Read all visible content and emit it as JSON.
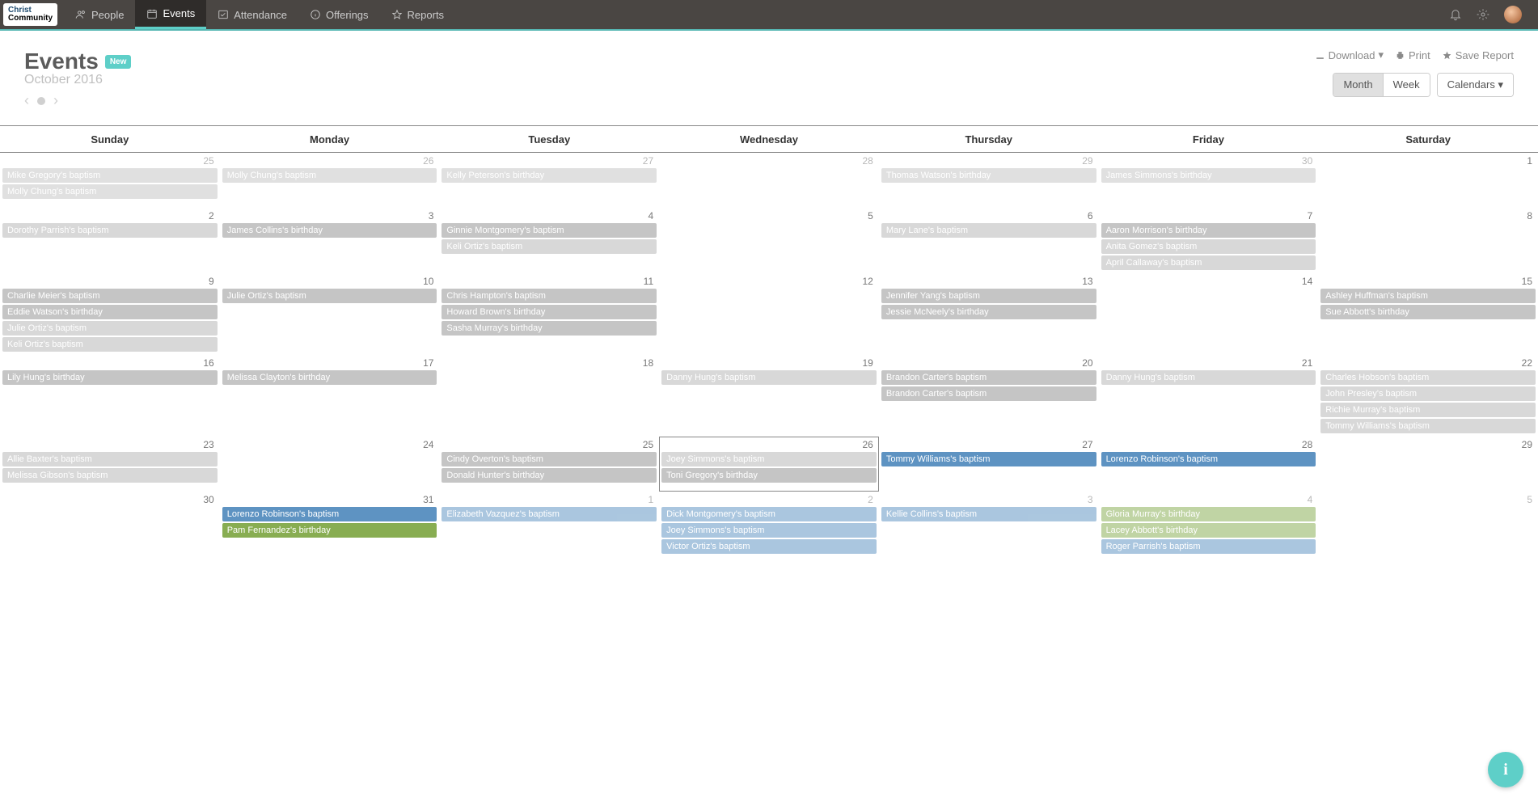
{
  "nav": {
    "logo_line1": "Christ",
    "logo_line2": "Community",
    "items": [
      {
        "label": "People",
        "icon": "people"
      },
      {
        "label": "Events",
        "icon": "calendar",
        "active": true
      },
      {
        "label": "Attendance",
        "icon": "check"
      },
      {
        "label": "Offerings",
        "icon": "info"
      },
      {
        "label": "Reports",
        "icon": "star"
      }
    ]
  },
  "header": {
    "title": "Events",
    "badge": "New",
    "subtitle": "October 2016",
    "actions": {
      "download": "Download",
      "print": "Print",
      "save": "Save Report"
    },
    "views": {
      "month": "Month",
      "week": "Week",
      "calendars": "Calendars"
    }
  },
  "dayheaders": [
    "Sunday",
    "Monday",
    "Tuesday",
    "Wednesday",
    "Thursday",
    "Friday",
    "Saturday"
  ],
  "weeks": [
    [
      {
        "num": "25",
        "other": true,
        "events": [
          {
            "t": "Mike Gregory's baptism",
            "c": "gray"
          },
          {
            "t": "Molly Chung's baptism",
            "c": "gray"
          }
        ]
      },
      {
        "num": "26",
        "other": true,
        "events": [
          {
            "t": "Molly Chung's baptism",
            "c": "gray"
          }
        ]
      },
      {
        "num": "27",
        "other": true,
        "events": [
          {
            "t": "Kelly Peterson's birthday",
            "c": "gray"
          }
        ]
      },
      {
        "num": "28",
        "other": true,
        "events": []
      },
      {
        "num": "29",
        "other": true,
        "events": [
          {
            "t": "Thomas Watson's birthday",
            "c": "gray"
          }
        ]
      },
      {
        "num": "30",
        "other": true,
        "events": [
          {
            "t": "James Simmons's birthday",
            "c": "gray"
          }
        ]
      },
      {
        "num": "1",
        "events": []
      }
    ],
    [
      {
        "num": "2",
        "events": [
          {
            "t": "Dorothy Parrish's baptism",
            "c": "lightgray"
          }
        ]
      },
      {
        "num": "3",
        "events": [
          {
            "t": "James Collins's birthday",
            "c": "gray"
          }
        ]
      },
      {
        "num": "4",
        "events": [
          {
            "t": "Ginnie Montgomery's baptism",
            "c": "gray"
          },
          {
            "t": "Keli Ortiz's baptism",
            "c": "lightgray"
          }
        ]
      },
      {
        "num": "5",
        "events": []
      },
      {
        "num": "6",
        "events": [
          {
            "t": "Mary Lane's baptism",
            "c": "lightgray"
          }
        ]
      },
      {
        "num": "7",
        "events": [
          {
            "t": "Aaron Morrison's birthday",
            "c": "gray"
          },
          {
            "t": "Anita Gomez's baptism",
            "c": "lightgray"
          },
          {
            "t": "April Callaway's baptism",
            "c": "lightgray"
          }
        ]
      },
      {
        "num": "8",
        "events": []
      }
    ],
    [
      {
        "num": "9",
        "events": [
          {
            "t": "Charlie Meier's baptism",
            "c": "gray"
          },
          {
            "t": "Eddie Watson's birthday",
            "c": "gray"
          },
          {
            "t": "Julie Ortiz's baptism",
            "c": "lightgray"
          },
          {
            "t": "Keli Ortiz's baptism",
            "c": "lightgray"
          }
        ]
      },
      {
        "num": "10",
        "events": [
          {
            "t": "Julie Ortiz's baptism",
            "c": "gray"
          }
        ]
      },
      {
        "num": "11",
        "events": [
          {
            "t": "Chris Hampton's baptism",
            "c": "gray"
          },
          {
            "t": "Howard Brown's birthday",
            "c": "gray"
          },
          {
            "t": "Sasha Murray's birthday",
            "c": "gray"
          }
        ]
      },
      {
        "num": "12",
        "events": []
      },
      {
        "num": "13",
        "events": [
          {
            "t": "Jennifer Yang's baptism",
            "c": "gray"
          },
          {
            "t": "Jessie McNeely's birthday",
            "c": "gray"
          }
        ]
      },
      {
        "num": "14",
        "events": []
      },
      {
        "num": "15",
        "events": [
          {
            "t": "Ashley Huffman's baptism",
            "c": "gray"
          },
          {
            "t": "Sue Abbott's birthday",
            "c": "gray"
          }
        ]
      }
    ],
    [
      {
        "num": "16",
        "events": [
          {
            "t": "Lily Hung's birthday",
            "c": "gray"
          }
        ]
      },
      {
        "num": "17",
        "events": [
          {
            "t": "Melissa Clayton's birthday",
            "c": "gray"
          }
        ]
      },
      {
        "num": "18",
        "events": []
      },
      {
        "num": "19",
        "events": [
          {
            "t": "Danny Hung's baptism",
            "c": "lightgray"
          }
        ]
      },
      {
        "num": "20",
        "events": [
          {
            "t": "Brandon Carter's baptism",
            "c": "gray"
          },
          {
            "t": "Brandon Carter's baptism",
            "c": "gray"
          }
        ]
      },
      {
        "num": "21",
        "events": [
          {
            "t": "Danny Hung's baptism",
            "c": "lightgray"
          }
        ]
      },
      {
        "num": "22",
        "events": [
          {
            "t": "Charles Hobson's baptism",
            "c": "lightgray"
          },
          {
            "t": "John Presley's baptism",
            "c": "lightgray"
          },
          {
            "t": "Richie Murray's baptism",
            "c": "lightgray"
          },
          {
            "t": "Tommy Williams's baptism",
            "c": "lightgray"
          }
        ]
      }
    ],
    [
      {
        "num": "23",
        "events": [
          {
            "t": "Allie Baxter's baptism",
            "c": "lightgray"
          },
          {
            "t": "Melissa Gibson's baptism",
            "c": "lightgray"
          }
        ]
      },
      {
        "num": "24",
        "events": []
      },
      {
        "num": "25",
        "events": [
          {
            "t": "Cindy Overton's baptism",
            "c": "gray"
          },
          {
            "t": "Donald Hunter's birthday",
            "c": "gray"
          }
        ]
      },
      {
        "num": "26",
        "today": true,
        "events": [
          {
            "t": "Joey Simmons's baptism",
            "c": "lightgray"
          },
          {
            "t": "Toni Gregory's birthday",
            "c": "gray"
          }
        ]
      },
      {
        "num": "27",
        "events": [
          {
            "t": "Tommy Williams's baptism",
            "c": "blue"
          }
        ]
      },
      {
        "num": "28",
        "events": [
          {
            "t": "Lorenzo Robinson's baptism",
            "c": "blue"
          }
        ]
      },
      {
        "num": "29",
        "events": []
      }
    ],
    [
      {
        "num": "30",
        "events": []
      },
      {
        "num": "31",
        "events": [
          {
            "t": "Lorenzo Robinson's baptism",
            "c": "blue"
          },
          {
            "t": "Pam Fernandez's birthday",
            "c": "green"
          }
        ]
      },
      {
        "num": "1",
        "other": true,
        "events": [
          {
            "t": "Elizabeth Vazquez's baptism",
            "c": "blue"
          }
        ]
      },
      {
        "num": "2",
        "other": true,
        "events": [
          {
            "t": "Dick Montgomery's baptism",
            "c": "blue"
          },
          {
            "t": "Joey Simmons's baptism",
            "c": "blue"
          },
          {
            "t": "Victor Ortiz's baptism",
            "c": "blue"
          }
        ]
      },
      {
        "num": "3",
        "other": true,
        "events": [
          {
            "t": "Kellie Collins's baptism",
            "c": "blue"
          }
        ]
      },
      {
        "num": "4",
        "other": true,
        "events": [
          {
            "t": "Gloria Murray's birthday",
            "c": "green"
          },
          {
            "t": "Lacey Abbott's birthday",
            "c": "green"
          },
          {
            "t": "Roger Parrish's baptism",
            "c": "blue"
          }
        ]
      },
      {
        "num": "5",
        "other": true,
        "events": []
      }
    ]
  ],
  "help": "i"
}
